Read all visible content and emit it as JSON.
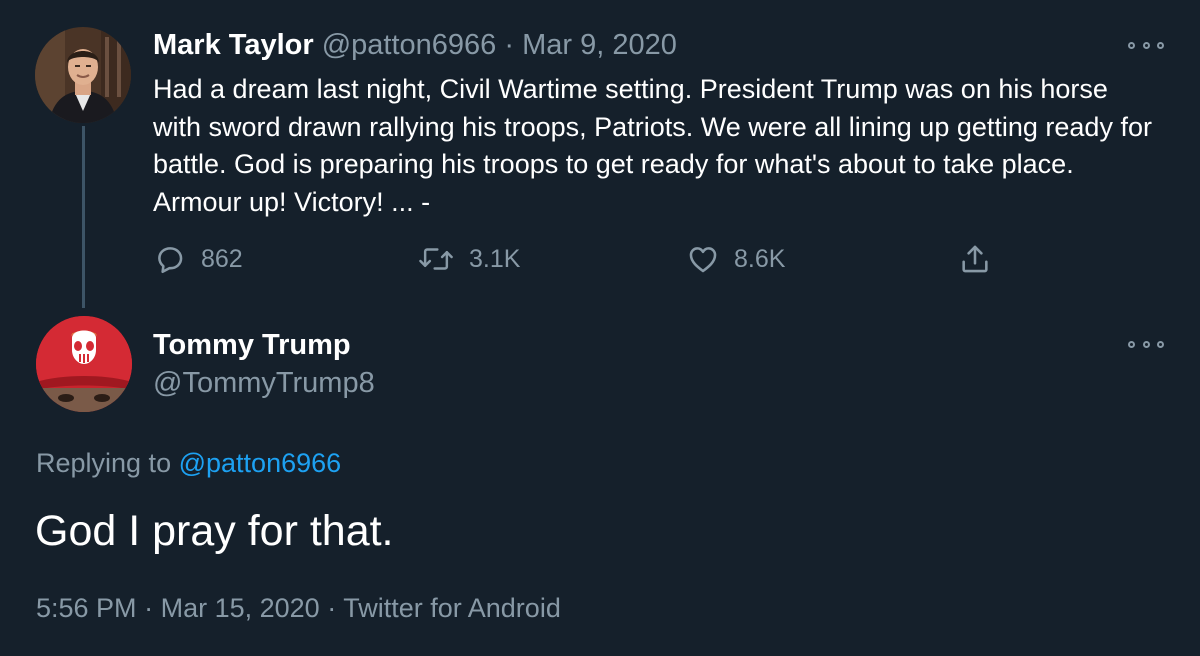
{
  "tweet1": {
    "author_name": "Mark Taylor",
    "handle": "@patton6966",
    "separator": "·",
    "date": "Mar 9, 2020",
    "text": "Had a dream last night, Civil Wartime setting. President Trump was on his horse with sword drawn rallying his troops, Patriots. We were all lining up getting ready for battle. God is preparing his troops to get ready for what's about to take place. Armour up! Victory! ... -",
    "replies": "862",
    "retweets": "3.1K",
    "likes": "8.6K"
  },
  "tweet2": {
    "author_name": "Tommy Trump",
    "handle": "@TommyTrump8",
    "replying_prefix": "Replying to",
    "replying_to": "@patton6966",
    "text": "God I pray for that.",
    "time": "5:56 PM",
    "separator": "·",
    "date": "Mar 15, 2020",
    "source": "Twitter for Android"
  },
  "theme": {
    "background": "#15202b",
    "muted_text": "#8899a6",
    "link": "#1da1f2",
    "thread_line": "#3d5466"
  },
  "icons": [
    "more-icon",
    "reply-icon",
    "retweet-icon",
    "like-icon",
    "share-icon"
  ]
}
